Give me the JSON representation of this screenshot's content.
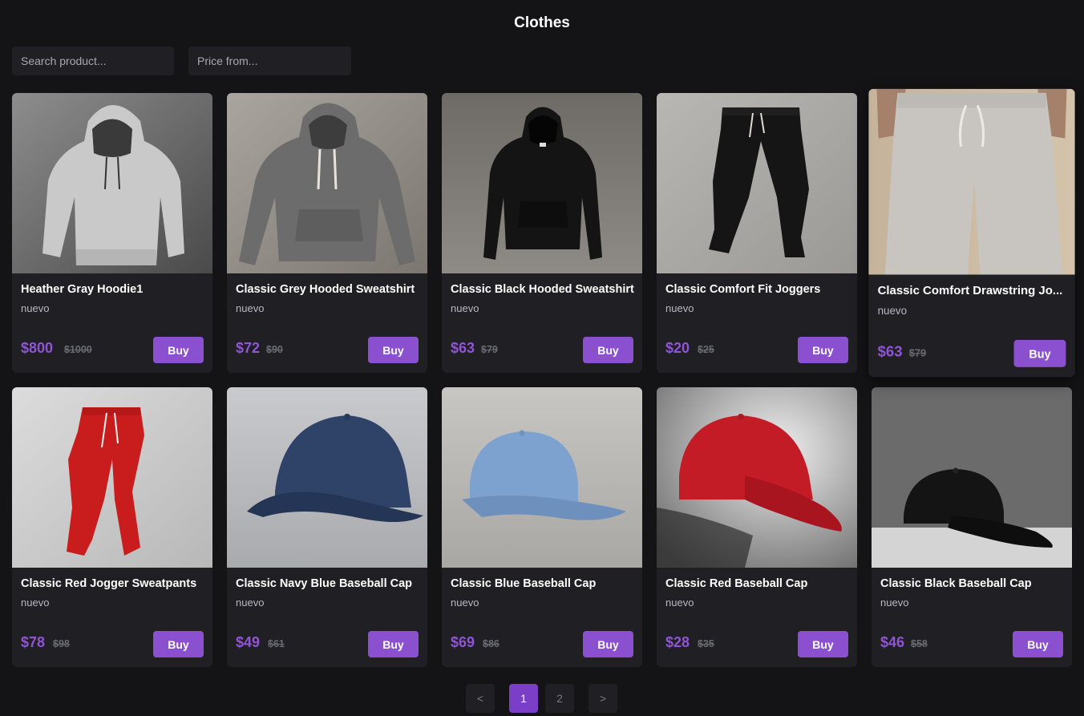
{
  "header": {
    "title": "Clothes"
  },
  "filters": {
    "search_placeholder": "Search product...",
    "price_placeholder": "Price from..."
  },
  "products": [
    {
      "name": "Heather Gray Hoodie1",
      "condition": "nuevo",
      "price": "$800",
      "old_price": "$1000",
      "buy_label": "Buy",
      "icon": "gray-hoodie-image"
    },
    {
      "name": "Classic Grey Hooded Sweatshirt",
      "condition": "nuevo",
      "price": "$72",
      "old_price": "$90",
      "buy_label": "Buy",
      "icon": "grey-sweatshirt-image"
    },
    {
      "name": "Classic Black Hooded Sweatshirt",
      "condition": "nuevo",
      "price": "$63",
      "old_price": "$79",
      "buy_label": "Buy",
      "icon": "black-hoodie-image"
    },
    {
      "name": "Classic Comfort Fit Joggers",
      "condition": "nuevo",
      "price": "$20",
      "old_price": "$25",
      "buy_label": "Buy",
      "icon": "black-joggers-image"
    },
    {
      "name": "Classic Comfort Drawstring Jo...",
      "condition": "nuevo",
      "price": "$63",
      "old_price": "$79",
      "buy_label": "Buy",
      "icon": "gray-drawstring-pants-image"
    },
    {
      "name": "Classic Red Jogger Sweatpants",
      "condition": "nuevo",
      "price": "$78",
      "old_price": "$98",
      "buy_label": "Buy",
      "icon": "red-joggers-image"
    },
    {
      "name": "Classic Navy Blue Baseball Cap",
      "condition": "nuevo",
      "price": "$49",
      "old_price": "$61",
      "buy_label": "Buy",
      "icon": "navy-cap-image"
    },
    {
      "name": "Classic Blue Baseball Cap",
      "condition": "nuevo",
      "price": "$69",
      "old_price": "$86",
      "buy_label": "Buy",
      "icon": "blue-cap-image"
    },
    {
      "name": "Classic Red Baseball Cap",
      "condition": "nuevo",
      "price": "$28",
      "old_price": "$35",
      "buy_label": "Buy",
      "icon": "red-cap-image"
    },
    {
      "name": "Classic Black Baseball Cap",
      "condition": "nuevo",
      "price": "$46",
      "old_price": "$58",
      "buy_label": "Buy",
      "icon": "black-cap-image"
    }
  ],
  "pagination": {
    "prev": "<",
    "pages": [
      "1",
      "2"
    ],
    "current": "1",
    "next": ">"
  },
  "colors": {
    "accent": "#8a50cf",
    "background": "#141417",
    "card": "#1f1f24"
  }
}
